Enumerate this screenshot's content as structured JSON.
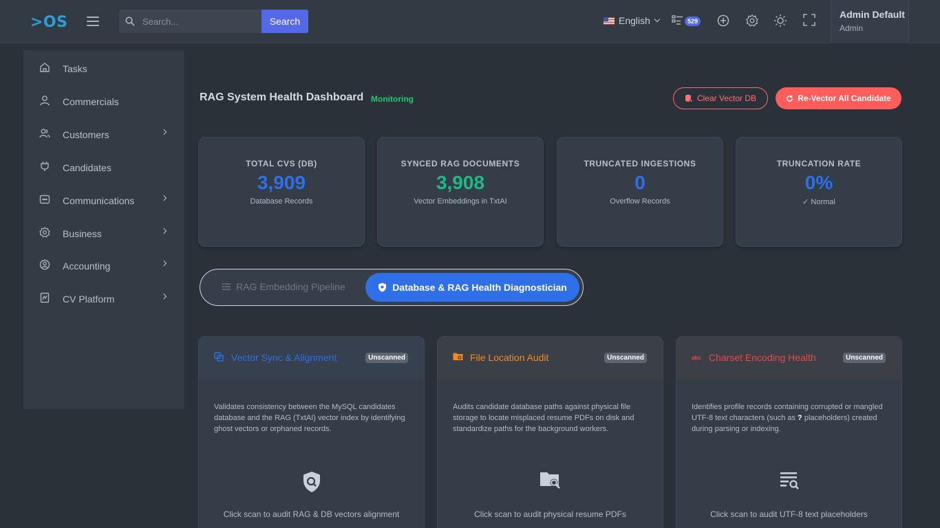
{
  "header": {
    "logo": ">OS",
    "search_placeholder": "Search...",
    "search_button": "Search",
    "language": "English",
    "task_badge": "529",
    "user_name": "Admin Default",
    "user_role": "Admin"
  },
  "sidebar": {
    "items": [
      {
        "label": "Tasks",
        "icon": "home-icon",
        "has_submenu": false
      },
      {
        "label": "Commercials",
        "icon": "user-icon",
        "has_submenu": false
      },
      {
        "label": "Customers",
        "icon": "users-icon",
        "has_submenu": true
      },
      {
        "label": "Candidates",
        "icon": "plug-icon",
        "has_submenu": false
      },
      {
        "label": "Communications",
        "icon": "chat-icon",
        "has_submenu": true
      },
      {
        "label": "Business",
        "icon": "gear-icon",
        "has_submenu": true
      },
      {
        "label": "Accounting",
        "icon": "account-icon",
        "has_submenu": true
      },
      {
        "label": "CV Platform",
        "icon": "document-icon",
        "has_submenu": true
      }
    ]
  },
  "page": {
    "title": "RAG System Health Dashboard",
    "status": "Monitoring",
    "clear_button": "Clear Vector DB",
    "revector_button": "Re-Vector All Candidate"
  },
  "stats": [
    {
      "label": "TOTAL CVS (DB)",
      "value": "3,909",
      "sub": "Database Records",
      "color": "#2f6fe8"
    },
    {
      "label": "SYNCED RAG DOCUMENTS",
      "value": "3,908",
      "sub": "Vector Embeddings in TxtAI",
      "color": "#20b883"
    },
    {
      "label": "TRUNCATED INGESTIONS",
      "value": "0",
      "sub": "Overflow Records",
      "color": "#2f6fe8"
    },
    {
      "label": "TRUNCATION RATE",
      "value": "0%",
      "sub": "✓ Normal",
      "color": "#2f6fe8"
    }
  ],
  "tabs": {
    "pipeline": "RAG Embedding Pipeline",
    "diagnostician": "Database & RAG Health Diagnostician"
  },
  "cards": [
    {
      "title": "Vector Sync & Alignment",
      "badge": "Unscanned",
      "description": "Validates consistency between the MySQL candidates database and the RAG (TxtAI) vector index by identifying ghost vectors or orphaned records.",
      "hint": "Click scan to audit RAG & DB vectors alignment",
      "accent": "#2f6fe8"
    },
    {
      "title": "File Location Audit",
      "badge": "Unscanned",
      "description": "Audits candidate database paths against physical file storage to locate misplaced resume PDFs on disk and standardize paths for the background workers.",
      "hint": "Click scan to audit physical resume PDFs",
      "accent": "#f08a24"
    },
    {
      "title": "Charset Encoding Health",
      "badge": "Unscanned",
      "description_before": "Identifies profile records containing corrupted or mangled UTF-8 text characters (such as ",
      "description_mark": "?",
      "description_after": " placeholders) created during parsing or indexing.",
      "hint": "Click scan to audit UTF-8 text placeholders",
      "accent": "#e5484d"
    }
  ],
  "colors": {
    "background": "#2b3138",
    "panel": "#353d48",
    "primary": "#2f6fe8",
    "danger": "#ff5c5c",
    "success": "#27c46b"
  }
}
